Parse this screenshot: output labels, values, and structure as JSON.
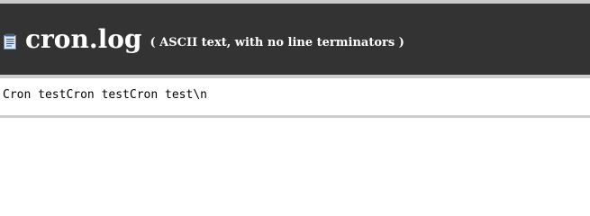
{
  "header": {
    "icon": "text-file-icon",
    "filename": "cron.log",
    "file_type": "( ASCII text, with no line terminators )"
  },
  "content": {
    "text": "Cron testCron testCron test\\n"
  },
  "colors": {
    "header_background": "#333333",
    "header_border": "#cccccc",
    "header_text": "#ffffff",
    "content_background": "#ffffff",
    "content_text": "#000000"
  }
}
